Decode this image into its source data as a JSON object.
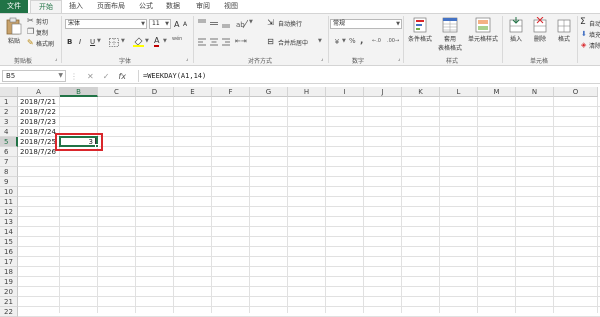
{
  "tabs": {
    "file": "文件",
    "home": "开始",
    "insert": "插入",
    "page_layout": "页面布局",
    "formulas": "公式",
    "data": "数据",
    "review": "审阅",
    "view": "视图"
  },
  "clipboard": {
    "paste": "粘贴",
    "cut": "剪切",
    "copy": "复制",
    "format_painter": "格式刷",
    "group_label": "剪贴板"
  },
  "font": {
    "name": "宋体",
    "size": "11",
    "bold": "B",
    "italic": "I",
    "underline": "U",
    "color_a": "A",
    "wen": "wén",
    "grow": "A",
    "shrink": "A",
    "group_label": "字体",
    "font_color": "#c00000",
    "fill_color": "#ffff00"
  },
  "alignment": {
    "wrap_text": "自动换行",
    "merge_center": "合并后居中",
    "group_label": "对齐方式"
  },
  "number": {
    "format": "常规",
    "percent": "%",
    "comma": ",",
    "group_label": "数字"
  },
  "styles": {
    "conditional": "条件格式",
    "format_table_1": "套用",
    "format_table_2": "表格格式",
    "cell_styles": "单元格样式",
    "group_label": "样式"
  },
  "cells": {
    "insert": "插入",
    "delete": "删除",
    "format": "格式",
    "group_label": "单元格"
  },
  "editing": {
    "autosum": "自动",
    "fill": "填充",
    "clear": "清除"
  },
  "formula_bar": {
    "name_box": "B5",
    "cancel": "✕",
    "enter": "✓",
    "fx": "fx",
    "formula": "=WEEKDAY(A1,14)"
  },
  "columns": [
    "A",
    "B",
    "C",
    "D",
    "E",
    "F",
    "G",
    "H",
    "I",
    "J",
    "K",
    "L",
    "M",
    "N",
    "O"
  ],
  "rows": [
    "1",
    "2",
    "3",
    "4",
    "5",
    "6",
    "7",
    "8",
    "9",
    "10",
    "11",
    "12",
    "13",
    "14",
    "15",
    "16",
    "17",
    "18",
    "19",
    "20",
    "21",
    "22"
  ],
  "cell_values": {
    "A1": "2018/7/21",
    "A2": "2018/7/22",
    "A3": "2018/7/23",
    "A4": "2018/7/24",
    "A5": "2018/7/25",
    "A6": "2018/7/26",
    "B5": "3"
  },
  "accent_color": "#217346",
  "highlight_color": "#d9262b"
}
